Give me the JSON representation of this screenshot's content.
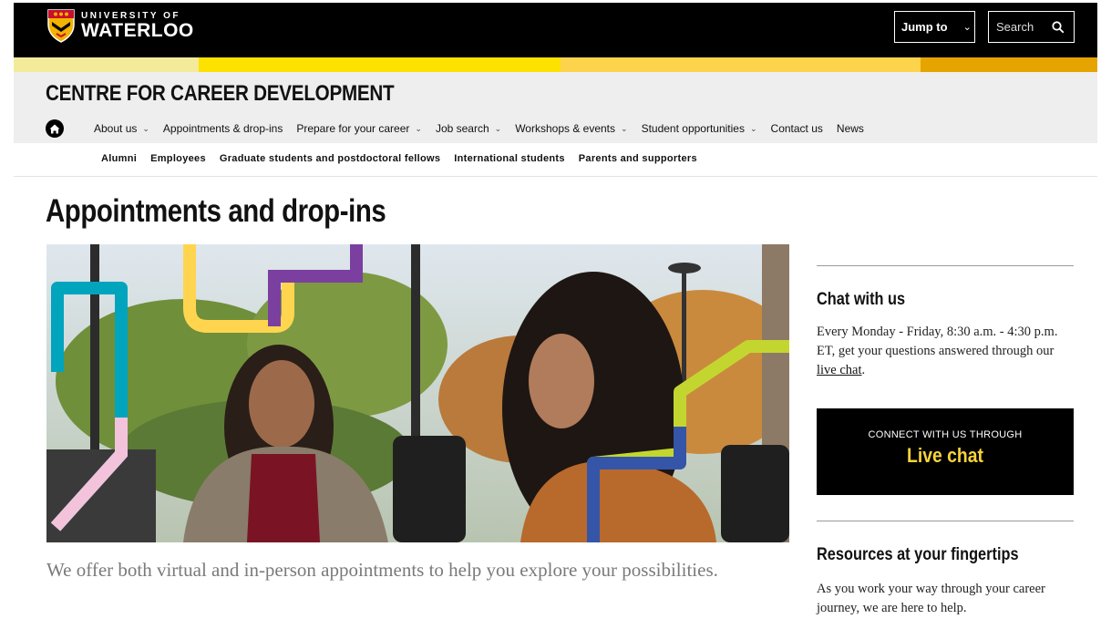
{
  "header": {
    "logo_small": "UNIVERSITY OF",
    "logo_big": "WATERLOO",
    "jump_label": "Jump to",
    "search_placeholder": "Search"
  },
  "site": {
    "title": "CENTRE FOR CAREER DEVELOPMENT"
  },
  "main_nav": [
    {
      "label": "About us",
      "has_menu": true
    },
    {
      "label": "Appointments & drop-ins",
      "has_menu": false
    },
    {
      "label": "Prepare for your career",
      "has_menu": true
    },
    {
      "label": "Job search",
      "has_menu": true
    },
    {
      "label": "Workshops & events",
      "has_menu": true
    },
    {
      "label": "Student opportunities",
      "has_menu": true
    },
    {
      "label": "Contact us",
      "has_menu": false
    },
    {
      "label": "News",
      "has_menu": false
    }
  ],
  "audience_nav": [
    "Alumni",
    "Employees",
    "Graduate students and postdoctoral fellows",
    "International students",
    "Parents and supporters"
  ],
  "page": {
    "title": "Appointments and drop-ins",
    "intro": "We offer both virtual and in-person appointments to help you explore your possibilities."
  },
  "sidebar": {
    "chat_heading": "Chat with us",
    "chat_text": "Every Monday - Friday, 8:30 a.m. - 4:30 p.m. ET, get your questions answered through our ",
    "chat_link": "live chat",
    "chat_text_end": ".",
    "cta_small": "CONNECT WITH US THROUGH",
    "cta_big": "Live chat",
    "resources_heading": "Resources at your fingertips",
    "resources_text": "As you work your way through your career journey, we are here to help."
  },
  "colors": {
    "gold_light": "#f4eb9a",
    "gold": "#fde100",
    "gold_mid": "#fed34c",
    "gold_dark": "#e6a400",
    "cta_accent": "#f8d33a"
  },
  "icons": {
    "home": "home-icon",
    "search": "search-icon",
    "jump_chevron": "chevron-down-icon"
  }
}
